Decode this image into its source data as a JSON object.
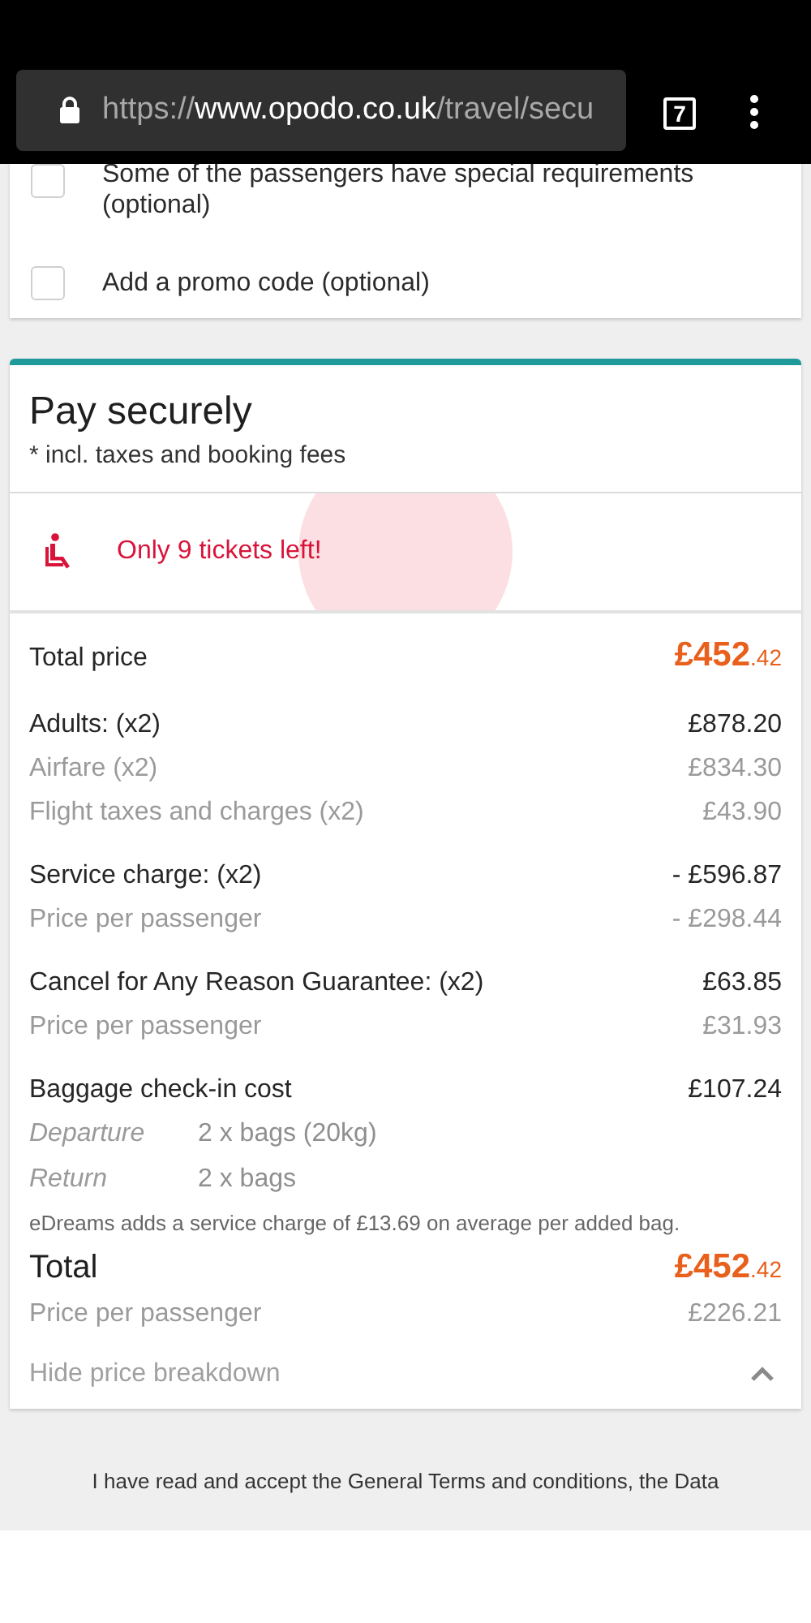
{
  "browser": {
    "url_scheme": "https://",
    "url_host": "www.opodo.co.uk",
    "url_path": "/travel/secu",
    "tab_count": "7"
  },
  "options": [
    {
      "label": "Some of the passengers have special requirements (optional)",
      "checked": false
    },
    {
      "label": "Add a promo code (optional)",
      "checked": false
    }
  ],
  "payment": {
    "title": "Pay securely",
    "subtitle": "* incl. taxes and booking fees",
    "alert": "Only 9 tickets left!",
    "summary": {
      "label": "Total price",
      "amount_main": "£452",
      "amount_decimals": ".42"
    },
    "groups": [
      {
        "lines": [
          {
            "kind": "main",
            "label": "Adults: (x2)",
            "amount": "£878.20"
          },
          {
            "kind": "sub",
            "label": "Airfare (x2)",
            "amount": "£834.30"
          },
          {
            "kind": "sub",
            "label": "Flight taxes and charges (x2)",
            "amount": "£43.90"
          }
        ]
      },
      {
        "lines": [
          {
            "kind": "main",
            "label": "Service charge: (x2)",
            "amount": "- £596.87"
          },
          {
            "kind": "sub",
            "label": "Price per passenger",
            "amount": "- £298.44"
          }
        ]
      },
      {
        "lines": [
          {
            "kind": "main",
            "label": "Cancel for Any Reason Guarantee: (x2)",
            "amount": "£63.85"
          },
          {
            "kind": "sub",
            "label": "Price per passenger",
            "amount": "£31.93"
          }
        ]
      }
    ],
    "baggage": {
      "label": "Baggage check-in cost",
      "amount": "£107.24",
      "legs": [
        {
          "label": "Departure",
          "value": "2 x bags (20kg)"
        },
        {
          "label": "Return",
          "value": "2 x bags"
        }
      ],
      "note": "eDreams adds a service charge of £13.69 on average per added bag."
    },
    "total": {
      "label": "Total",
      "amount_main": "£452",
      "amount_decimals": ".42",
      "per_label": "Price per passenger",
      "per_amount": "£226.21"
    },
    "toggle": {
      "label": "Hide price breakdown",
      "expanded": true
    }
  },
  "terms": {
    "text": "I have read and accept the General Terms and conditions, the Data"
  }
}
